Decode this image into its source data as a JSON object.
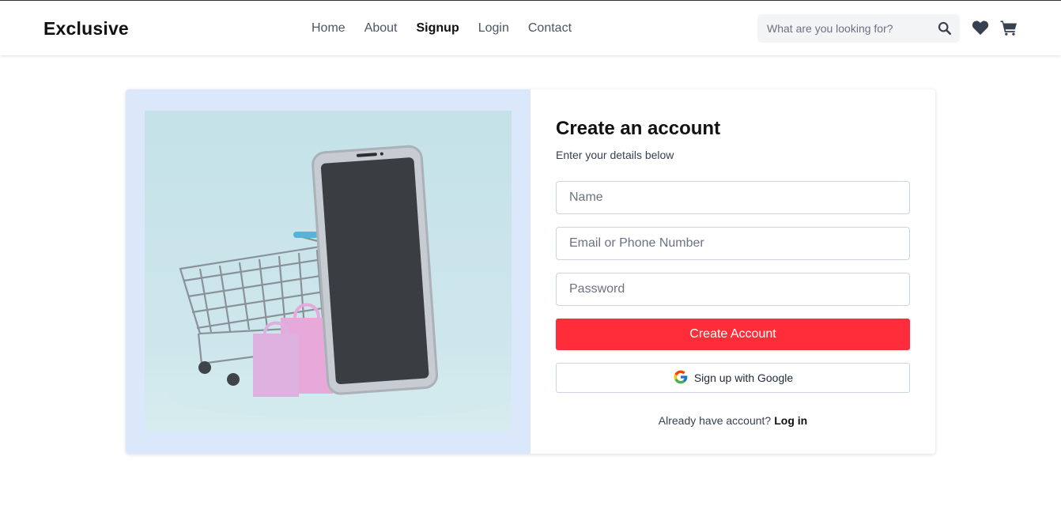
{
  "header": {
    "brand": "Exclusive",
    "nav": [
      {
        "label": "Home",
        "active": false
      },
      {
        "label": "About",
        "active": false
      },
      {
        "label": "Signup",
        "active": true
      },
      {
        "label": "Login",
        "active": false
      },
      {
        "label": "Contact",
        "active": false
      }
    ],
    "search": {
      "placeholder": "What are you looking for?",
      "icon": "search-icon"
    },
    "icons": [
      "heart-icon",
      "cart-icon"
    ]
  },
  "hero": {
    "illustration": "smartphone with shopping cart and bags",
    "colors": {
      "panel": "#dbe8fb",
      "image_bg": "#c4e2e8"
    }
  },
  "form": {
    "title": "Create an account",
    "subtitle": "Enter your details below",
    "name_placeholder": "Name",
    "email_placeholder": "Email or Phone Number",
    "password_placeholder": "Password",
    "submit_label": "Create Account",
    "google_label": "Sign up with Google",
    "login_prompt": "Already have account?",
    "login_link": "Log in"
  },
  "colors": {
    "accent": "#ff2d3a",
    "text": "#111111"
  }
}
